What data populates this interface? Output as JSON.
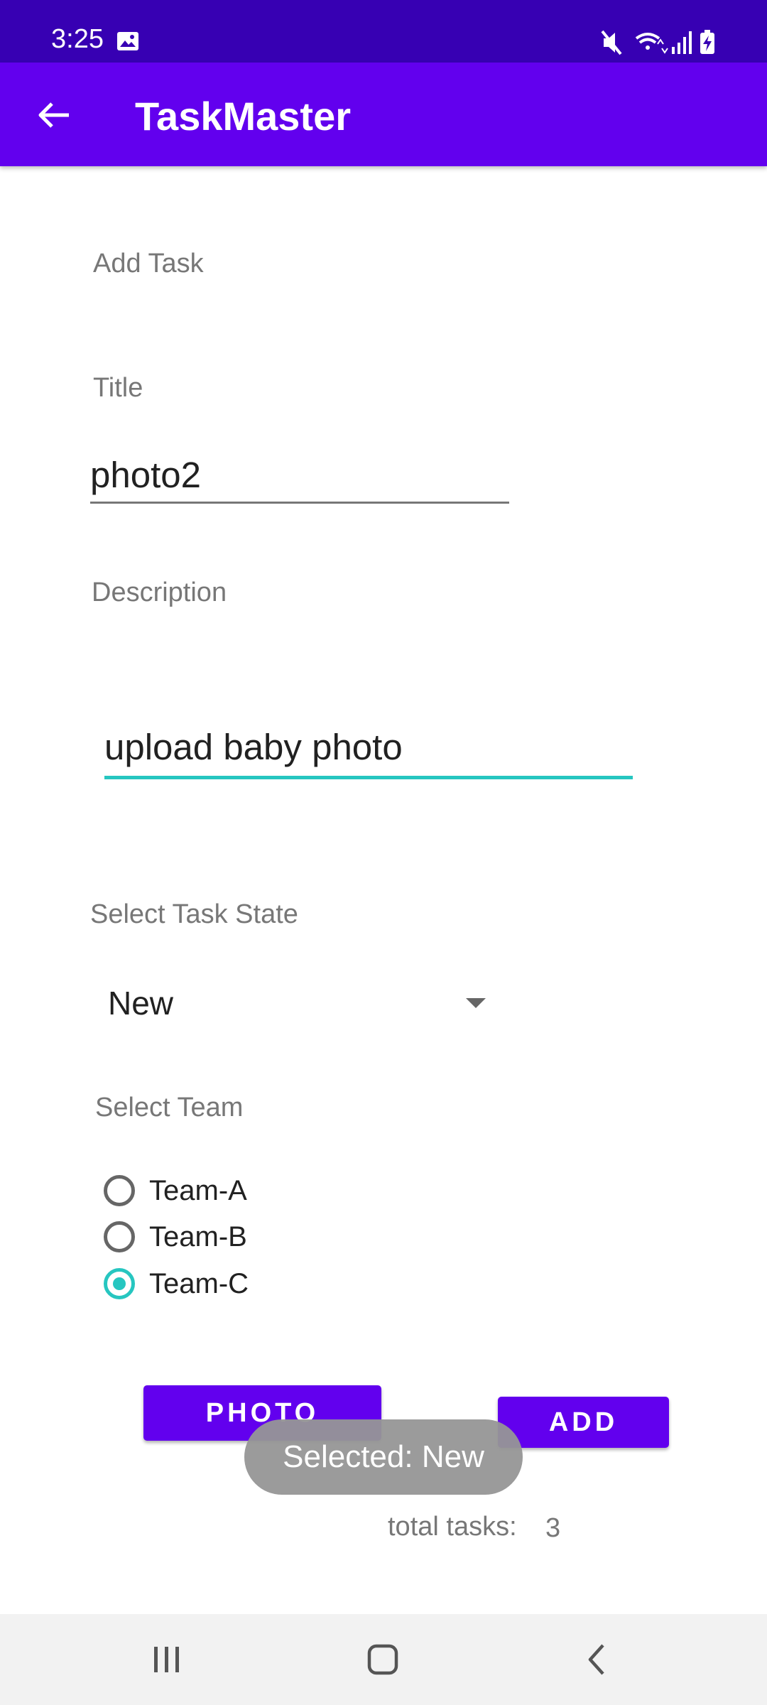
{
  "status_bar": {
    "time": "3:25",
    "icons": [
      "gallery-icon",
      "mute-icon",
      "wifi-icon",
      "signal-icon",
      "battery-charging-icon"
    ]
  },
  "app_bar": {
    "title": "TaskMaster",
    "back_icon": "arrow-back-icon"
  },
  "form": {
    "heading": "Add Task",
    "title_label": "Title",
    "title_value": "photo2",
    "description_label": "Description",
    "description_value": "upload baby photo",
    "state_label": "Select Task State",
    "state_value": "New",
    "team_label": "Select Team",
    "teams": [
      {
        "label": "Team-A",
        "checked": false
      },
      {
        "label": "Team-B",
        "checked": false
      },
      {
        "label": "Team-C",
        "checked": true
      }
    ],
    "photo_button": "PHOTO",
    "add_button": "ADD"
  },
  "toast": "Selected: New",
  "total": {
    "label": "total tasks:",
    "value": "3"
  },
  "colors": {
    "status_bar": "#3700b3",
    "primary": "#6200ee",
    "accent": "#26c6c0"
  },
  "nav_bar": [
    "recents-icon",
    "home-icon",
    "back-icon"
  ]
}
